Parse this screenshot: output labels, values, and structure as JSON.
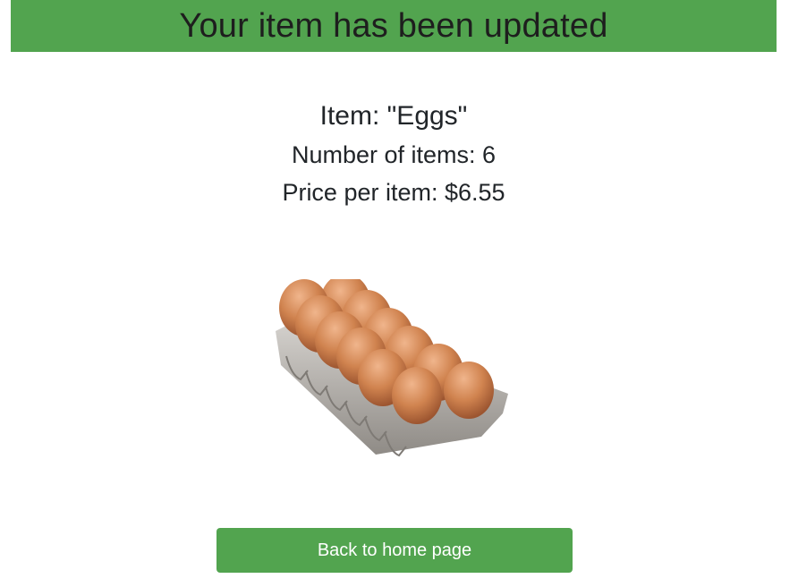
{
  "banner": {
    "title": "Your item has been updated"
  },
  "item": {
    "name_line": "Item: \"Eggs\"",
    "count_line": "Number of items: 6",
    "price_line": "Price per item: $6.55"
  },
  "image": {
    "alt": "Eggs"
  },
  "actions": {
    "back_label": "Back to home page"
  },
  "colors": {
    "accent": "#52a44f",
    "text": "#212529",
    "carton": "#b9b6b2",
    "egg": "#c9784a"
  }
}
